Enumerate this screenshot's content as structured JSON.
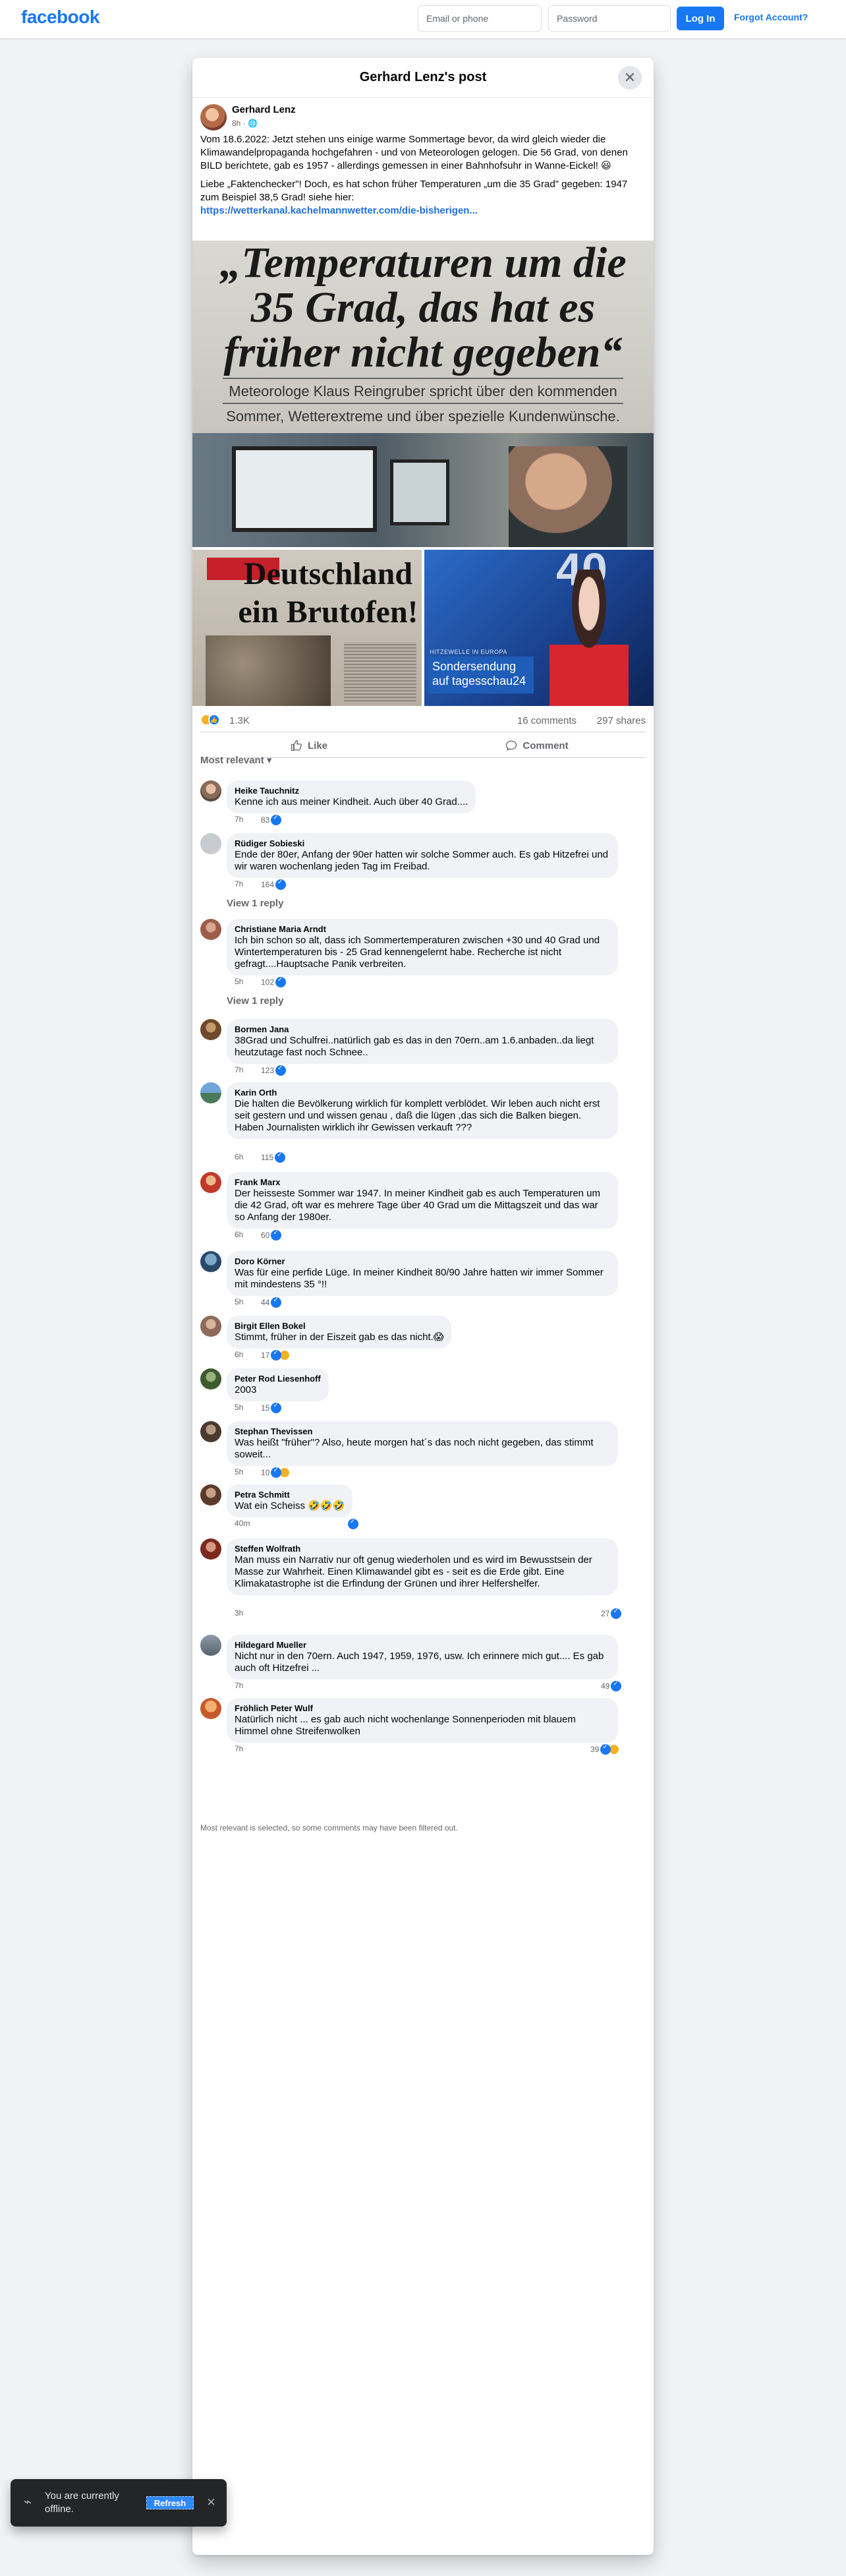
{
  "topbar": {
    "logo": "facebook",
    "email_placeholder": "Email or phone",
    "password_placeholder": "Password",
    "login_label": "Log In",
    "forgot_label": "Forgot Account?"
  },
  "modal": {
    "title": "Gerhard Lenz's post",
    "close_icon": "close-icon"
  },
  "post": {
    "author": "Gerhard Lenz",
    "meta": "8h · 🌐",
    "paragraph1": "Vom 18.6.2022: Jetzt stehen uns einige warme Sommertage bevor, da wird gleich wieder die Klimawandelpropaganda hochgefahren - und von Meteorologen gelogen. Die 56 Grad, von denen BILD berichtete, gab es 1957 - allerdings gemessen in einer Bahnhofsuhr in Wanne-Eickel! 😃",
    "paragraph2": "Liebe „Faktenchecker\"! Doch, es hat schon früher Temperaturen „um die 35 Grad\" gegeben: 1947 zum Beispiel 38,5 Grad! siehe hier:",
    "link": "https://wetterkanal.kachelmannwetter.com/die-bisherigen..."
  },
  "images": {
    "main_headline_lines": [
      "„Temperaturen um die",
      "35 Grad, das hat es",
      "früher nicht gegeben“"
    ],
    "main_subline1": "Meteorologe Klaus Reingruber spricht über den kommenden",
    "main_subline2": "Sommer, Wetterextreme und über spezielle Kundenwünsche.",
    "bild_line1": "Deutschland",
    "bild_line2": "ein Brutofen!",
    "ts_number": "40",
    "ts_kicker": "HITZEWELLE IN EUROPA",
    "ts_box": "Sondersendung auf tagesschau24"
  },
  "stats": {
    "reactions": "1.3K",
    "comments": "16 comments",
    "shares": "297 shares"
  },
  "actions": {
    "like": "Like",
    "comment": "Comment"
  },
  "sort_label": "Most relevant ▾",
  "comments": [
    {
      "name": "Heike Tauchnitz",
      "text": "Kenne ich aus meiner Kindheit. Auch über 40 Grad....",
      "age": "7h",
      "count": "83",
      "reply": ""
    },
    {
      "name": "Rüdiger Sobieski",
      "text": "Ende der 80er, Anfang der 90er hatten wir solche Sommer auch. Es gab Hitzefrei und wir waren wochenlang jeden Tag im Freibad.",
      "age": "7h",
      "count": "164",
      "reply": "View 1 reply"
    },
    {
      "name": "Christiane Maria Arndt",
      "text": "Ich bin schon so alt, dass ich Sommertemperaturen zwischen +30 und 40 Grad und Wintertemperaturen bis - 25 Grad kennengelernt habe. Recherche ist nicht gefragt....Hauptsache Panik verbreiten.",
      "age": "5h",
      "count": "102",
      "reply": "View 1 reply"
    },
    {
      "name": "Bormen Jana",
      "text": "38Grad und Schulfrei..natürlich gab es das in den 70ern..am 1.6.anbaden..da liegt heutzutage fast noch Schnee..",
      "age": "7h",
      "count": "123",
      "reply": ""
    },
    {
      "name": "Karin Orth",
      "text": "Die halten die Bevölkerung wirklich für komplett verblödet. Wir leben auch nicht erst seit gestern und und wissen genau , daß die lügen ,das sich die Balken biegen. Haben Journalisten wirklich ihr Gewissen verkauft ???",
      "age": "6h",
      "count": "115",
      "reply": ""
    },
    {
      "name": "Frank Marx",
      "text": "Der heisseste Sommer war 1947. In meiner Kindheit gab es auch Temperaturen um die 42 Grad, oft war es mehrere Tage über 40 Grad um die Mittagszeit und das war so Anfang der 1980er.",
      "age": "6h",
      "count": "60",
      "reply": ""
    },
    {
      "name": "Doro Körner",
      "text": "Was für eine perfide Lüge. In meiner Kindheit 80/90 Jahre hatten wir immer Sommer mit mindestens 35 °!!",
      "age": "5h",
      "count": "44",
      "reply": ""
    },
    {
      "name": "Birgit Ellen Bokel",
      "text": "Stimmt, früher in der Eiszeit gab es das nicht.😱",
      "age": "6h",
      "count": "17",
      "reply": ""
    },
    {
      "name": "Peter Rod Liesenhoff",
      "text": "2003",
      "age": "5h",
      "count": "15",
      "reply": ""
    },
    {
      "name": "Stephan Thevissen",
      "text": "Was heißt \"früher\"? Also, heute morgen hat´s das noch nicht gegeben, das stimmt soweit...",
      "age": "5h",
      "count": "10",
      "reply": ""
    },
    {
      "name": "Petra Schmitt",
      "text": "Wat ein Scheiss 🤣🤣🤣",
      "age": "40m",
      "count": "",
      "reply": ""
    },
    {
      "name": "Steffen Wolfrath",
      "text": "Man muss ein Narrativ nur oft genug wiederholen und es wird im Bewusstsein der Masse zur Wahrheit. Einen Klimawandel gibt es - seit es die Erde gibt. Eine Klimakatastrophe ist die Erfindung der Grünen und ihrer Helfershelfer.",
      "age": "3h",
      "count": "27",
      "reply": ""
    },
    {
      "name": "Hildegard Mueller",
      "text": "Nicht nur in den 70ern. Auch 1947, 1959, 1976, usw. Ich erinnere mich gut.... Es gab auch oft Hitzefrei ...",
      "age": "7h",
      "count": "49",
      "reply": ""
    },
    {
      "name": "Fröhlich Peter Wulf",
      "text": "Natürlich nicht ... es gab auch nicht wochenlange Sonnenperioden mit blauem Himmel ohne Streifenwolken",
      "age": "7h",
      "count": "39",
      "reply": ""
    }
  ],
  "filter_note": "Most relevant is selected, so some comments may have been filtered out.",
  "toast": {
    "text": "You are currently offline.",
    "refresh": "Refresh",
    "close": "×"
  },
  "colors": {
    "brand": "#1877f2",
    "link": "#216fdb",
    "muted": "#65676b",
    "bubble": "#f0f2f5"
  }
}
